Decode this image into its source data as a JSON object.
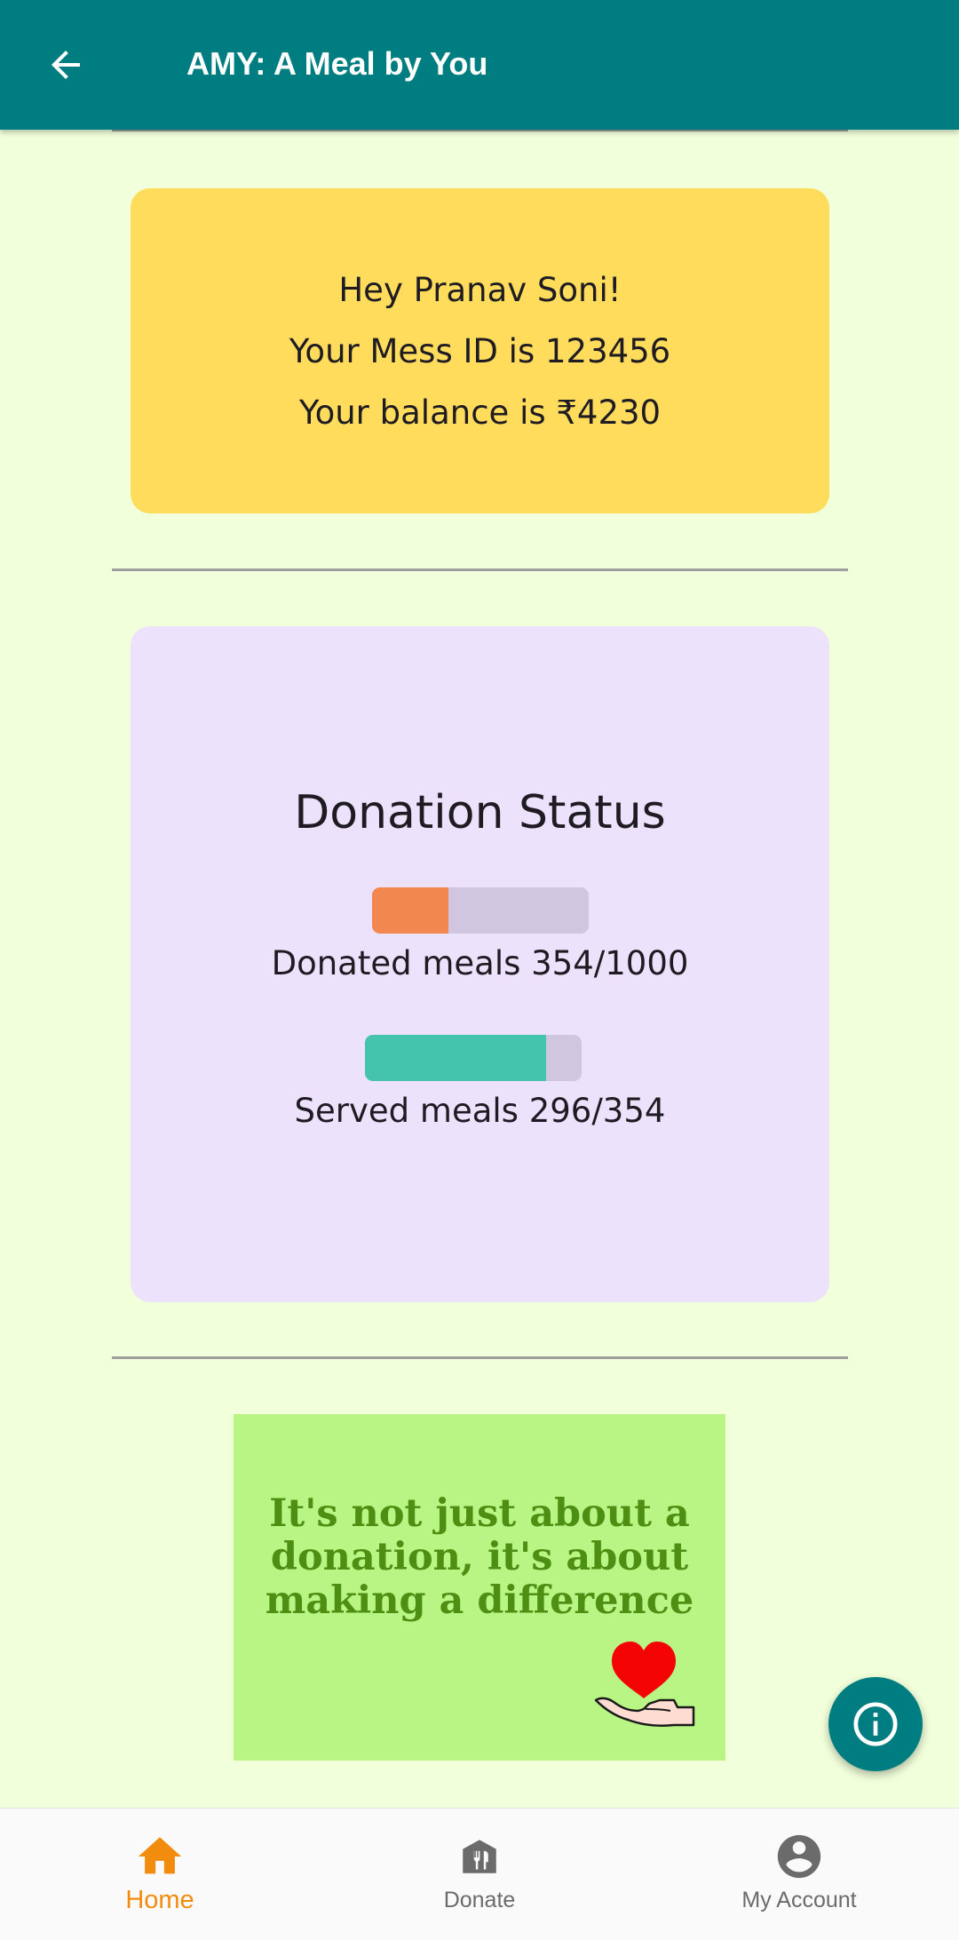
{
  "app_bar": {
    "title": "AMY: A Meal by You",
    "back_icon": "arrow-back-icon",
    "background": "#007D80"
  },
  "greeting_card": {
    "line1": "Hey Pranav Soni!",
    "line2": "Your Mess ID is 123456",
    "line3": "Your balance is ₹4230",
    "background": "#FFDC5C"
  },
  "donation_status": {
    "title": "Donation Status",
    "donated": {
      "label": "Donated meals 354/1000",
      "value": 354,
      "total": 1000,
      "color": "#F2874F"
    },
    "served": {
      "label": "Served meals 296/354",
      "value": 296,
      "total": 354,
      "color": "#44C4AD"
    },
    "background": "#EDE2FC"
  },
  "banner": {
    "quote_line1": "It's not just about a",
    "quote_line2": "donation, it's about",
    "quote_line3": "making a difference",
    "icon": "heart-in-hand-icon",
    "background": "#B8F585"
  },
  "fab": {
    "icon": "info-icon"
  },
  "bottom_nav": {
    "items": [
      {
        "label": "Home",
        "icon": "home-icon",
        "active": true
      },
      {
        "label": "Donate",
        "icon": "restaurant-icon",
        "active": false
      },
      {
        "label": "My Account",
        "icon": "account-circle-icon",
        "active": false
      }
    ],
    "active_color": "#F28C0F",
    "inactive_color": "#6B6B6B"
  }
}
